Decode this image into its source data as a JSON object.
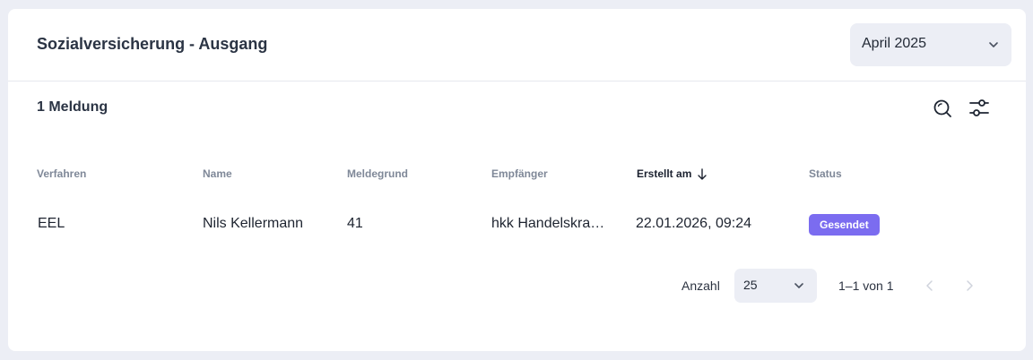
{
  "header": {
    "title": "Sozialversicherung - Ausgang",
    "month": "April 2025"
  },
  "toolbar": {
    "count_label": "1 Meldung",
    "icons": [
      "search-icon",
      "filter-sliders-icon"
    ]
  },
  "table": {
    "columns": [
      "Verfahren",
      "Name",
      "Meldegrund",
      "Empfänger",
      "Erstellt am",
      "Status"
    ],
    "sorted_column": "Erstellt am",
    "sort_direction": "descending",
    "rows": [
      {
        "verfahren": "EEL",
        "name": "Nils Kellermann",
        "meldegrund": "41",
        "empfaenger": "hkk Handelskrankenkasse",
        "erstellt_am": "22.01.2026, 09:24",
        "status": "Gesendet"
      }
    ]
  },
  "pagination": {
    "size_label": "Anzahl",
    "page_size": "25",
    "range": "1–1 von 1"
  },
  "colors": {
    "page_background": "#eceef5",
    "status_badge": "#7b6cf0",
    "header_text": "#2b3444",
    "muted_text": "#7f8898"
  }
}
